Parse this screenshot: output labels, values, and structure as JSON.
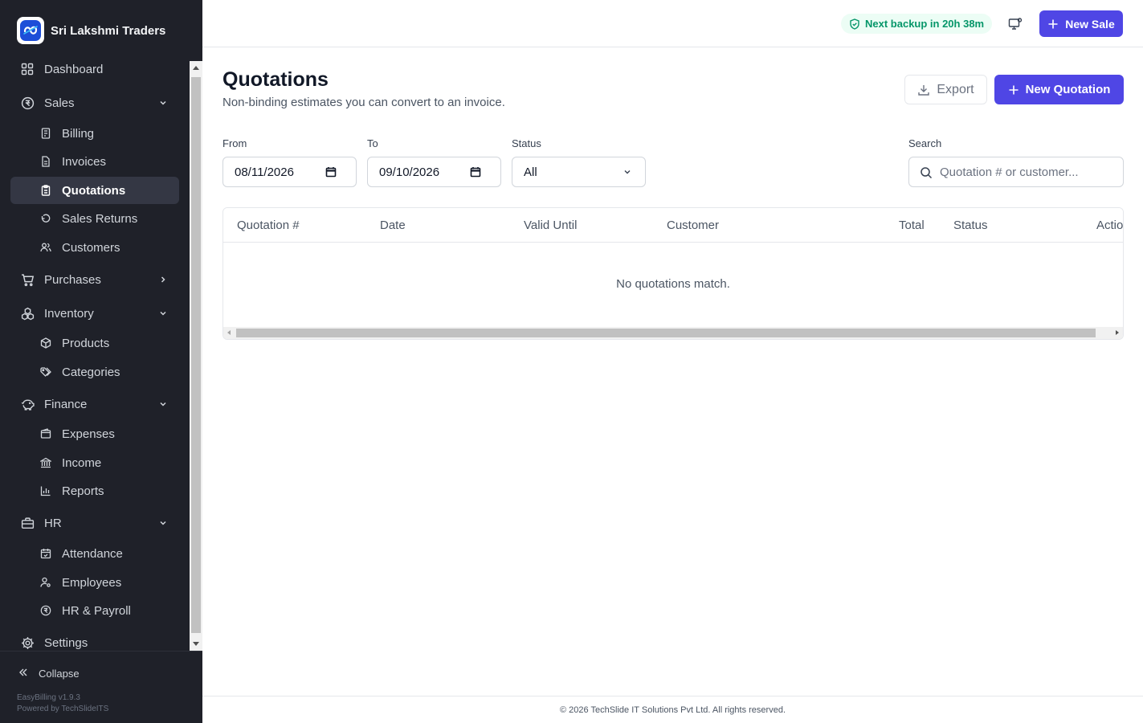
{
  "brand": {
    "name": "Sri Lakshmi Traders",
    "logo_icon": "brand-logo-icon"
  },
  "colors": {
    "accent": "#4f46e5",
    "sidebar_bg": "#1f2129",
    "sidebar_active": "#343744",
    "backup_text": "#059669",
    "backup_bg": "#ecfdf5"
  },
  "sidebar": {
    "items": [
      {
        "label": "Dashboard",
        "icon": "dashboard-icon",
        "level": "top"
      },
      {
        "label": "Sales",
        "icon": "rupee-circle-icon",
        "level": "top",
        "expanded": true
      },
      {
        "label": "Billing",
        "icon": "receipt-icon",
        "level": "sub"
      },
      {
        "label": "Invoices",
        "icon": "document-icon",
        "level": "sub"
      },
      {
        "label": "Quotations",
        "icon": "clipboard-icon",
        "level": "sub",
        "active": true
      },
      {
        "label": "Sales Returns",
        "icon": "undo-icon",
        "level": "sub"
      },
      {
        "label": "Customers",
        "icon": "users-icon",
        "level": "sub"
      },
      {
        "label": "Purchases",
        "icon": "cart-icon",
        "level": "top",
        "expanded": false
      },
      {
        "label": "Inventory",
        "icon": "boxes-icon",
        "level": "top",
        "expanded": true
      },
      {
        "label": "Products",
        "icon": "package-icon",
        "level": "sub"
      },
      {
        "label": "Categories",
        "icon": "tags-icon",
        "level": "sub"
      },
      {
        "label": "Finance",
        "icon": "piggy-bank-icon",
        "level": "top",
        "expanded": true
      },
      {
        "label": "Expenses",
        "icon": "wallet-icon",
        "level": "sub"
      },
      {
        "label": "Income",
        "icon": "bank-icon",
        "level": "sub"
      },
      {
        "label": "Reports",
        "icon": "bar-chart-icon",
        "level": "sub"
      },
      {
        "label": "HR",
        "icon": "briefcase-icon",
        "level": "top",
        "expanded": true
      },
      {
        "label": "Attendance",
        "icon": "calendar-check-icon",
        "level": "sub"
      },
      {
        "label": "Employees",
        "icon": "user-cog-icon",
        "level": "sub"
      },
      {
        "label": "HR & Payroll",
        "icon": "rupee-circle-icon",
        "level": "sub"
      },
      {
        "label": "Settings",
        "icon": "gear-icon",
        "level": "top"
      }
    ],
    "collapse_label": "Collapse",
    "version": "EasyBilling v1.9.3",
    "powered_by": "Powered by TechSlideITS"
  },
  "topbar": {
    "backup_text": "Next backup in 20h 38m",
    "new_sale_label": "New Sale"
  },
  "page": {
    "title": "Quotations",
    "subtitle": "Non-binding estimates you can convert to an invoice.",
    "export_label": "Export",
    "new_quotation_label": "New Quotation"
  },
  "filters": {
    "from_label": "From",
    "from_value": "08/11/2026",
    "to_label": "To",
    "to_value": "09/10/2026",
    "status_label": "Status",
    "status_value": "All",
    "search_label": "Search",
    "search_placeholder": "Quotation # or customer..."
  },
  "table": {
    "columns": [
      "Quotation #",
      "Date",
      "Valid Until",
      "Customer",
      "Total",
      "Status",
      "Actions"
    ],
    "empty_message": "No quotations match."
  },
  "footer": {
    "text": "© 2026 TechSlide IT Solutions Pvt Ltd. All rights reserved."
  }
}
